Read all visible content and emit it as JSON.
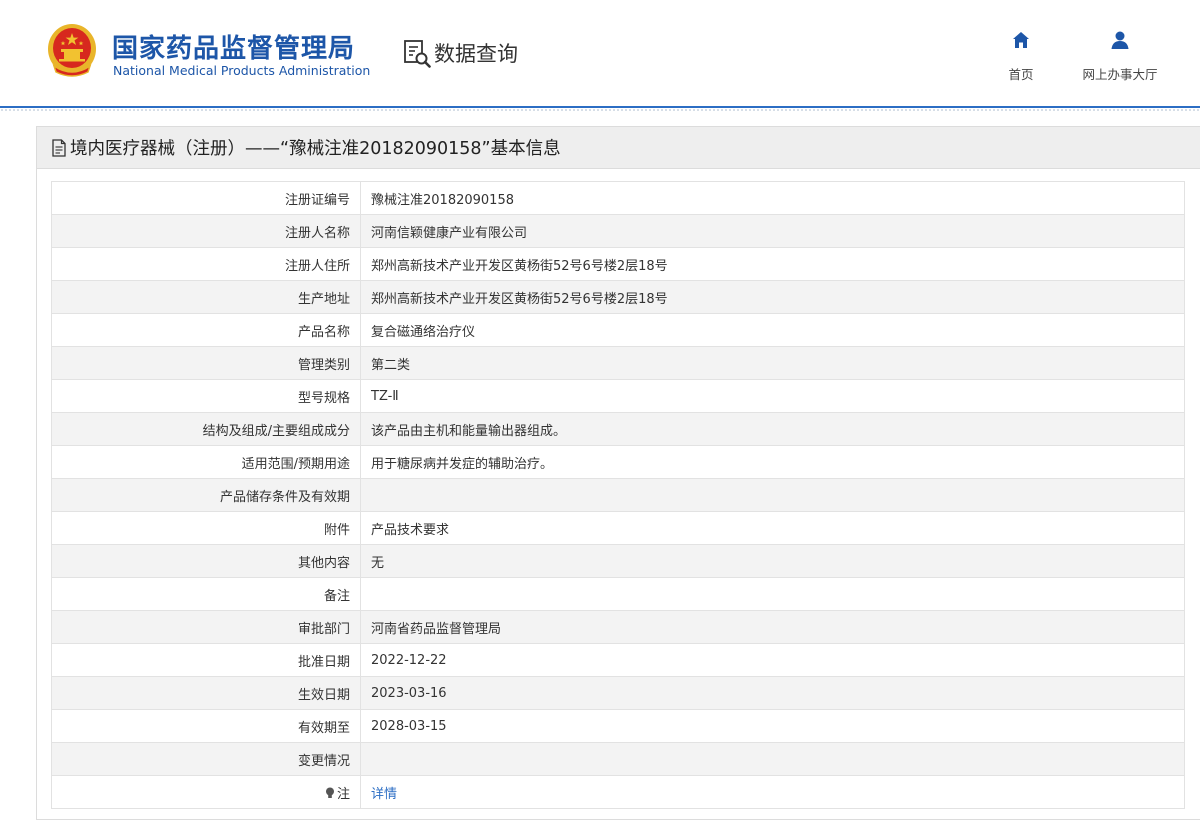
{
  "header": {
    "agency_name_cn": "国家药品监督管理局",
    "agency_name_en": "National Medical Products Administration",
    "section": "数据查询",
    "nav": [
      {
        "label": "首页",
        "icon": "home-icon"
      },
      {
        "label": "网上办事大厅",
        "icon": "user-icon"
      }
    ]
  },
  "panel": {
    "title": "境内医疗器械（注册）——“豫械注准20182090158”基本信息"
  },
  "rows": [
    {
      "label": "注册证编号",
      "value": "豫械注准20182090158"
    },
    {
      "label": "注册人名称",
      "value": "河南信颖健康产业有限公司"
    },
    {
      "label": "注册人住所",
      "value": "郑州高新技术产业开发区黄杨街52号6号楼2层18号"
    },
    {
      "label": "生产地址",
      "value": "郑州高新技术产业开发区黄杨街52号6号楼2层18号"
    },
    {
      "label": "产品名称",
      "value": "复合磁通络治疗仪"
    },
    {
      "label": "管理类别",
      "value": "第二类"
    },
    {
      "label": "型号规格",
      "value": "TZ-Ⅱ"
    },
    {
      "label": "结构及组成/主要组成成分",
      "value": "该产品由主机和能量输出器组成。"
    },
    {
      "label": "适用范围/预期用途",
      "value": "用于糖尿病并发症的辅助治疗。"
    },
    {
      "label": "产品储存条件及有效期",
      "value": ""
    },
    {
      "label": "附件",
      "value": "产品技术要求"
    },
    {
      "label": "其他内容",
      "value": "无"
    },
    {
      "label": "备注",
      "value": ""
    },
    {
      "label": "审批部门",
      "value": "河南省药品监督管理局"
    },
    {
      "label": "批准日期",
      "value": "2022-12-22"
    },
    {
      "label": "生效日期",
      "value": "2023-03-16"
    },
    {
      "label": "有效期至",
      "value": "2028-03-15"
    },
    {
      "label": "变更情况",
      "value": ""
    },
    {
      "label": "注",
      "value": "详情"
    }
  ],
  "colors": {
    "brand_blue": "#1d56a8",
    "link_blue": "#2c6ec4",
    "emblem_red": "#d7281e",
    "emblem_gold": "#f2c230"
  }
}
